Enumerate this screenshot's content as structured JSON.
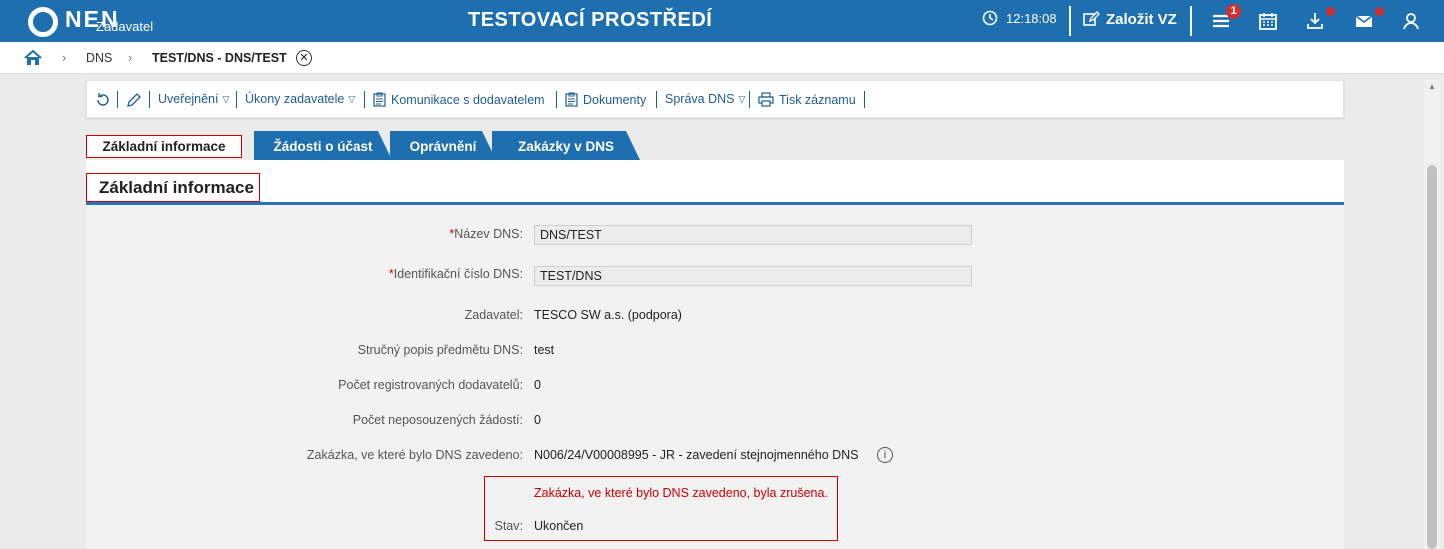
{
  "app": {
    "logo": "NEN",
    "logo_sub": "Zadavatel",
    "env_title": "TESTOVACÍ PROSTŘEDÍ",
    "time": "12:18:08",
    "create_label": "Založit VZ",
    "menu_badge": "1"
  },
  "breadcrumb": {
    "items": [
      "DNS",
      "TEST/DNS - DNS/TEST"
    ]
  },
  "toolbar": {
    "publish": "Uveřejnění",
    "actions": "Úkony zadavatele",
    "communication": "Komunikace s dodavatelem",
    "documents": "Dokumenty",
    "manage": "Správa DNS",
    "print": "Tisk záznamu"
  },
  "tabs": [
    "Základní informace",
    "Žádosti o účast",
    "Oprávnění",
    "Zakázky v DNS"
  ],
  "section": {
    "title": "Základní informace"
  },
  "form": {
    "name_label": "Název DNS:",
    "name_value": "DNS/TEST",
    "id_label": "Identifikační číslo DNS:",
    "id_value": "TEST/DNS",
    "contracting_label": "Zadavatel:",
    "contracting_value": "TESCO SW a.s. (podpora)",
    "desc_label": "Stručný popis předmětu DNS:",
    "desc_value": "test",
    "registered_label": "Počet registrovaných dodavatelů:",
    "registered_value": "0",
    "pending_label": "Počet neposouzených žádostí:",
    "pending_value": "0",
    "contract_label": "Zakázka, ve které bylo DNS zavedeno:",
    "contract_value": "N006/24/V00008995 - JR - zavedení stejnojmenného DNS",
    "warning": "Zakázka, ve které bylo DNS zavedeno, byla zrušena.",
    "state_label": "Stav:",
    "state_value": "Ukončen"
  },
  "colors": {
    "brand": "#1e6fb0",
    "alert": "#cc0000"
  }
}
